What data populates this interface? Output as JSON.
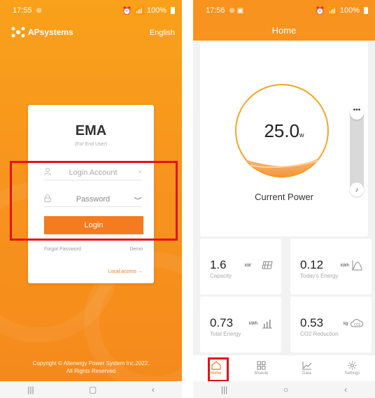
{
  "colors": {
    "brand_orange": "#f7931e",
    "button_orange": "#f47b20",
    "highlight_red": "#e4121a"
  },
  "login_screen": {
    "status_time": "17:55",
    "status_battery": "100%",
    "brand_name": "APsystems",
    "language": "English",
    "app_title": "EMA",
    "app_subtitle": "(For End User)",
    "account_placeholder": "Login Account",
    "password_placeholder": "Password",
    "login_label": "Login",
    "forgot_password": "Forgot Password",
    "demo": "Demo",
    "local_access": "Local access →",
    "copyright_line1": "Copyright © Altenergy Power System Inc.2022.",
    "copyright_line2": "All Rights Reserved",
    "nav": {
      "recent": "|||",
      "home": "▢",
      "back": "‹"
    }
  },
  "home_screen": {
    "status_time": "17:56",
    "status_battery": "100%",
    "title": "Home",
    "current_power": {
      "value": "25.0",
      "unit": "w",
      "label": "Current Power"
    },
    "side_menu_icon": "more-icon",
    "tiles": [
      {
        "value": "1.6",
        "unit": "kW",
        "label": "Capacity",
        "icon": "solar-panel-icon"
      },
      {
        "value": "0.12",
        "unit": "kWh",
        "label": "Today's Energy",
        "icon": "energy-curve-icon"
      },
      {
        "value": "0.73",
        "unit": "kWh",
        "label": "Total Energy",
        "icon": "bar-chart-icon"
      },
      {
        "value": "0.53",
        "unit": "kg",
        "label": "CO2 Reduction",
        "icon": "co2-cloud-icon"
      }
    ],
    "tabs": [
      {
        "label": "Home",
        "icon": "home-icon",
        "active": true
      },
      {
        "label": "Module",
        "icon": "module-grid-icon",
        "active": false
      },
      {
        "label": "Data",
        "icon": "line-chart-icon",
        "active": false
      },
      {
        "label": "Settings",
        "icon": "gear-icon",
        "active": false
      }
    ],
    "nav": {
      "recent": "|||",
      "home": "○",
      "back": "‹"
    }
  }
}
